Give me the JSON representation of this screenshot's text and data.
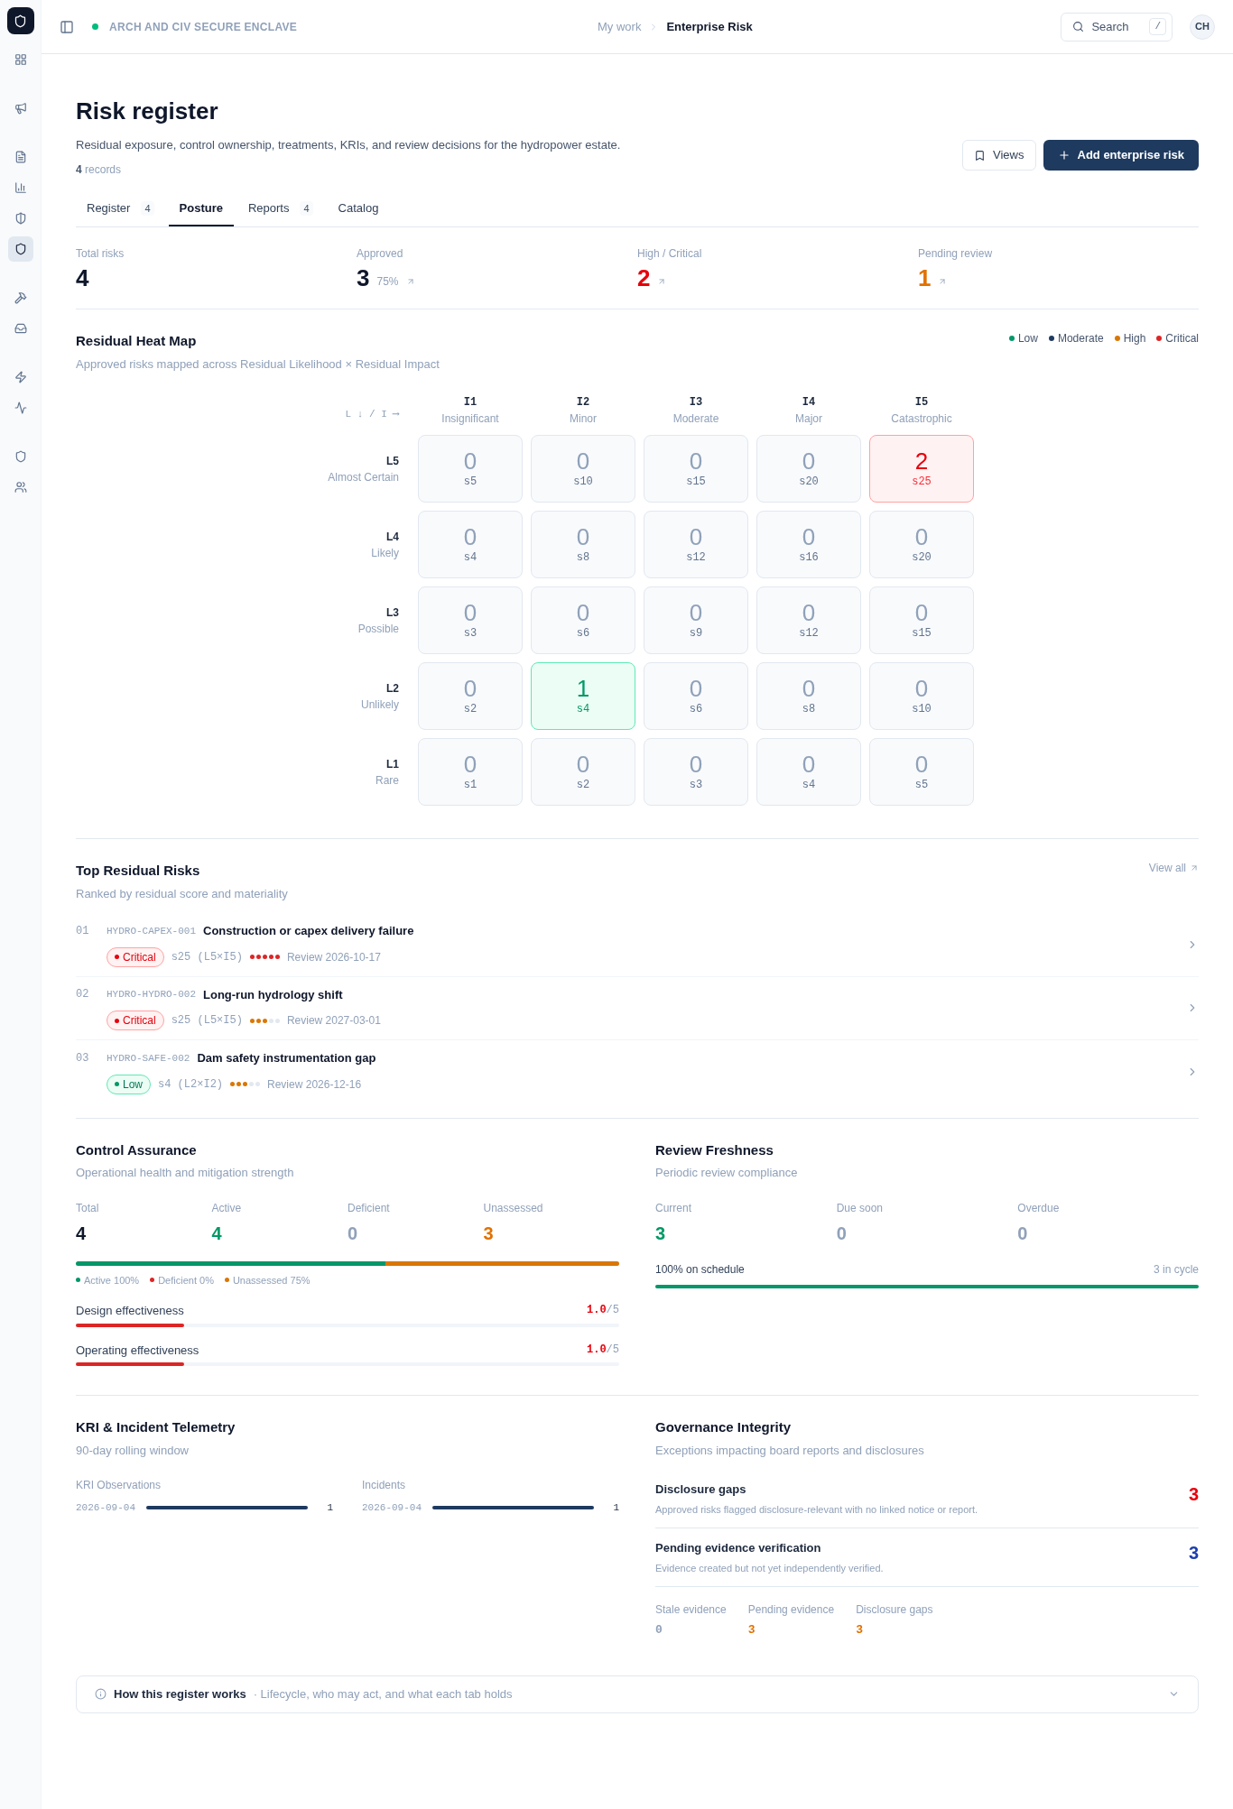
{
  "sidebar": {
    "items": [
      {
        "selected": false
      },
      {
        "selected": false
      },
      {
        "selected": false
      },
      {
        "selected": false
      },
      {
        "selected": false
      },
      {
        "selected": true
      },
      {
        "selected": false
      },
      {
        "selected": false
      },
      {
        "selected": false
      },
      {
        "selected": false
      },
      {
        "selected": false
      },
      {
        "selected": false
      }
    ]
  },
  "topbar": {
    "workspace": "ARCH AND CIV SECURE ENCLAVE",
    "breadcrumb": [
      "My work",
      "Enterprise Risk"
    ],
    "search": "Search",
    "search_key": "/",
    "avatar": "CH"
  },
  "page": {
    "title": "Risk register",
    "description": "Residual exposure, control ownership, treatments, KRIs, and review decisions for the hydropower estate.",
    "record_count": "4",
    "record_label": "records",
    "views_button": "Views",
    "add_button": "Add enterprise risk"
  },
  "tabs": [
    {
      "label": "Register",
      "count": "4",
      "selected": false
    },
    {
      "label": "Posture",
      "selected": true
    },
    {
      "label": "Reports",
      "count": "4",
      "selected": false
    },
    {
      "label": "Catalog",
      "selected": false
    }
  ],
  "stats": [
    {
      "label": "Total risks",
      "value": "4",
      "kind": "default"
    },
    {
      "label": "Approved",
      "value": "3",
      "sub": "75%",
      "kind": "default",
      "link": true
    },
    {
      "label": "High / Critical",
      "value": "2",
      "kind": "critical",
      "link": true
    },
    {
      "label": "Pending review",
      "value": "1",
      "kind": "warning",
      "link": true
    }
  ],
  "heat_map": {
    "title": "Residual Heat Map",
    "subtitle": "Approved risks mapped across Residual Likelihood × Residual Impact",
    "legend": [
      {
        "label": "Low",
        "color": "#059669"
      },
      {
        "label": "Moderate",
        "color": "#1e3a5f"
      },
      {
        "label": "High",
        "color": "#d97706"
      },
      {
        "label": "Critical",
        "color": "#dc2626"
      }
    ],
    "axis_label": "L ↓ / I ⟶",
    "columns": [
      {
        "code": "I1",
        "name": "Insignificant"
      },
      {
        "code": "I2",
        "name": "Minor"
      },
      {
        "code": "I3",
        "name": "Moderate"
      },
      {
        "code": "I4",
        "name": "Major"
      },
      {
        "code": "I5",
        "name": "Catastrophic"
      }
    ],
    "rows": [
      {
        "code": "L5",
        "name": "Almost Certain",
        "cells": [
          {
            "count": "0",
            "score": "s5",
            "kind": "empty"
          },
          {
            "count": "0",
            "score": "s10",
            "kind": "empty"
          },
          {
            "count": "0",
            "score": "s15",
            "kind": "empty"
          },
          {
            "count": "0",
            "score": "s20",
            "kind": "empty"
          },
          {
            "count": "2",
            "score": "s25",
            "kind": "critical"
          }
        ]
      },
      {
        "code": "L4",
        "name": "Likely",
        "cells": [
          {
            "count": "0",
            "score": "s4",
            "kind": "empty"
          },
          {
            "count": "0",
            "score": "s8",
            "kind": "empty"
          },
          {
            "count": "0",
            "score": "s12",
            "kind": "empty"
          },
          {
            "count": "0",
            "score": "s16",
            "kind": "empty"
          },
          {
            "count": "0",
            "score": "s20",
            "kind": "empty"
          }
        ]
      },
      {
        "code": "L3",
        "name": "Possible",
        "cells": [
          {
            "count": "0",
            "score": "s3",
            "kind": "empty"
          },
          {
            "count": "0",
            "score": "s6",
            "kind": "empty"
          },
          {
            "count": "0",
            "score": "s9",
            "kind": "empty"
          },
          {
            "count": "0",
            "score": "s12",
            "kind": "empty"
          },
          {
            "count": "0",
            "score": "s15",
            "kind": "empty"
          }
        ]
      },
      {
        "code": "L2",
        "name": "Unlikely",
        "cells": [
          {
            "count": "0",
            "score": "s2",
            "kind": "empty"
          },
          {
            "count": "1",
            "score": "s4",
            "kind": "low"
          },
          {
            "count": "0",
            "score": "s6",
            "kind": "empty"
          },
          {
            "count": "0",
            "score": "s8",
            "kind": "empty"
          },
          {
            "count": "0",
            "score": "s10",
            "kind": "empty"
          }
        ]
      },
      {
        "code": "L1",
        "name": "Rare",
        "cells": [
          {
            "count": "0",
            "score": "s1",
            "kind": "empty"
          },
          {
            "count": "0",
            "score": "s2",
            "kind": "empty"
          },
          {
            "count": "0",
            "score": "s3",
            "kind": "empty"
          },
          {
            "count": "0",
            "score": "s4",
            "kind": "empty"
          },
          {
            "count": "0",
            "score": "s5",
            "kind": "empty"
          }
        ]
      }
    ]
  },
  "top_risks": {
    "title": "Top Residual Risks",
    "subtitle": "Ranked by residual score and materiality",
    "view_all": "View all",
    "items": [
      {
        "rank": "01",
        "id": "HYDRO-CAPEX-001",
        "title": "Construction or capex delivery failure",
        "badge": "Critical",
        "kind": "critical",
        "score": "s25 (L5×I5)",
        "stars": 5,
        "color": "#dc2626",
        "review": "Review 2026-10-17"
      },
      {
        "rank": "02",
        "id": "HYDRO-HYDRO-002",
        "title": "Long-run hydrology shift",
        "badge": "Critical",
        "kind": "critical",
        "score": "s25 (L5×I5)",
        "stars": 3,
        "color": "#d97706",
        "review": "Review 2027-03-01"
      },
      {
        "rank": "03",
        "id": "HYDRO-SAFE-002",
        "title": "Dam safety instrumentation gap",
        "badge": "Low",
        "kind": "low",
        "score": "s4 (L2×I2)",
        "stars": 3,
        "color": "#d97706",
        "review": "Review 2026-12-16"
      }
    ]
  },
  "control_assurance": {
    "title": "Control Assurance",
    "subtitle": "Operational health and mitigation strength",
    "stats": [
      {
        "label": "Total",
        "value": "4",
        "kind": "default"
      },
      {
        "label": "Active",
        "value": "4",
        "kind": "success"
      },
      {
        "label": "Deficient",
        "value": "0",
        "kind": "muted"
      },
      {
        "label": "Unassessed",
        "value": "3",
        "kind": "warning"
      }
    ],
    "bar": [
      {
        "level": 0.57,
        "color": "#059669"
      },
      {
        "level": 0.43,
        "color": "#d97706"
      }
    ],
    "legend": [
      {
        "label": "Active 100%",
        "color": "#059669"
      },
      {
        "label": "Deficient 0%",
        "color": "#dc2626"
      },
      {
        "label": "Unassessed 75%",
        "color": "#d97706"
      }
    ],
    "effectiveness": [
      {
        "label": "Design effectiveness",
        "score": "1.0",
        "max": "/5",
        "level": 0.2
      },
      {
        "label": "Operating effectiveness",
        "score": "1.0",
        "max": "/5",
        "level": 0.2
      }
    ]
  },
  "review_freshness": {
    "title": "Review Freshness",
    "subtitle": "Periodic review compliance",
    "stats": [
      {
        "label": "Current",
        "value": "3",
        "kind": "success"
      },
      {
        "label": "Due soon",
        "value": "0",
        "kind": "muted"
      },
      {
        "label": "Overdue",
        "value": "0",
        "kind": "muted"
      }
    ],
    "schedule_label": "100% on schedule",
    "cycle": "3 in cycle",
    "level": 1
  },
  "telemetry": {
    "title": "KRI & Incident Telemetry",
    "subtitle": "90-day rolling window",
    "series": [
      {
        "label": "KRI Observations",
        "date": "2026-09-04",
        "value": "1",
        "level": 1
      },
      {
        "label": "Incidents",
        "date": "2026-09-04",
        "value": "1",
        "level": 1
      }
    ]
  },
  "governance": {
    "title": "Governance Integrity",
    "subtitle": "Exceptions impacting board reports and disclosures",
    "items": [
      {
        "title": "Disclosure gaps",
        "description": "Approved risks flagged disclosure-relevant with no linked notice or report.",
        "value": "3",
        "kind": "critical"
      },
      {
        "title": "Pending evidence verification",
        "description": "Evidence created but not yet independently verified.",
        "value": "3",
        "kind": "info"
      }
    ],
    "stats": [
      {
        "label": "Stale evidence",
        "value": "0",
        "kind": "muted"
      },
      {
        "label": "Pending evidence",
        "value": "3",
        "kind": "warning"
      },
      {
        "label": "Disclosure gaps",
        "value": "3",
        "kind": "warning"
      }
    ]
  },
  "help": {
    "title": "How this register works",
    "subtitle": "· Lifecycle, who may act, and what each tab holds",
    "expanded": false
  }
}
